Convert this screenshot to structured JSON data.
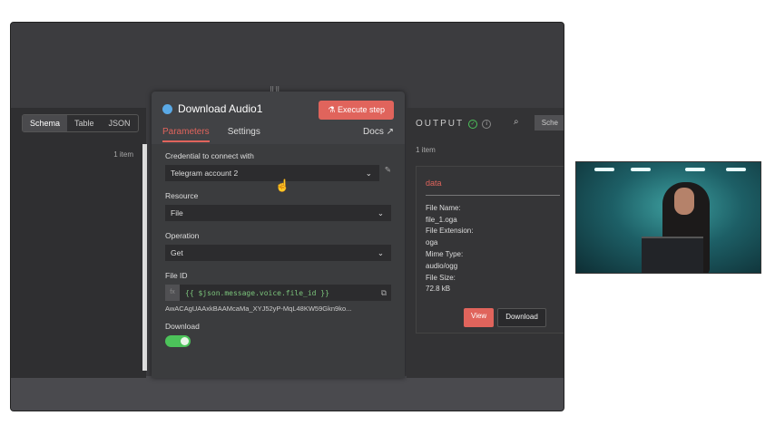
{
  "left_panel": {
    "tabs": [
      "Schema",
      "Table",
      "JSON"
    ],
    "item_count": "1 item"
  },
  "node": {
    "title": "Download Audio1",
    "execute_label": "Execute step",
    "tabs": [
      "Parameters",
      "Settings"
    ],
    "docs_label": "Docs",
    "credential_label": "Credential to connect with",
    "credential_value": "Telegram account 2",
    "resource_label": "Resource",
    "resource_value": "File",
    "operation_label": "Operation",
    "operation_value": "Get",
    "file_id_label": "File ID",
    "file_id_expr": "{{ $json.message.voice.file_id }}",
    "file_id_fx": "fx",
    "file_id_preview": "AwACAgUAAxkBAAMcaMa_XYJ52yP-MqL48KW59Gkn9ko...",
    "download_label": "Download",
    "download_on": true
  },
  "output": {
    "title": "OUTPUT",
    "schema_tab": "Sche",
    "item_count": "1 item",
    "binary": {
      "name": "data",
      "fields": [
        "File Name:",
        "file_1.oga",
        "File Extension:",
        "oga",
        "Mime Type:",
        "audio/ogg",
        "File Size:",
        "72.8 kB"
      ],
      "view_label": "View",
      "download_label": "Download"
    }
  },
  "colors": {
    "accent": "#e0645c",
    "toggle": "#4cc35a"
  }
}
